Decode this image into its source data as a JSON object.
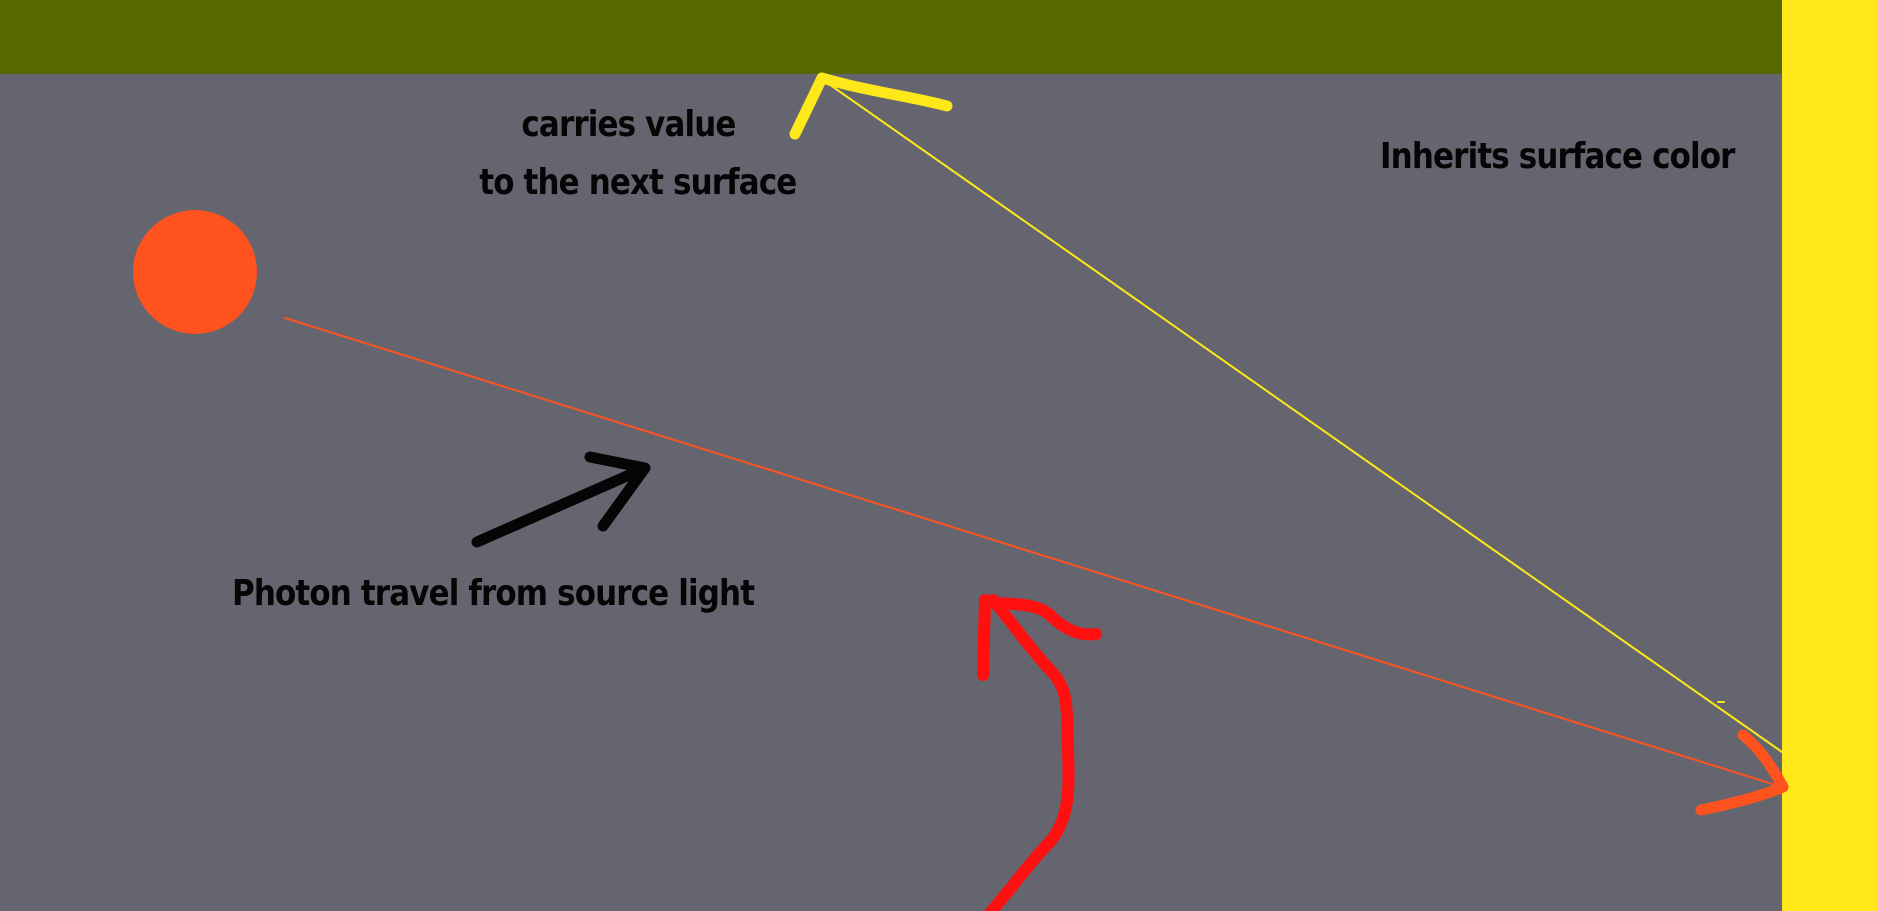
{
  "diagram": {
    "labels": {
      "top_line_1": "carries value",
      "top_line_2": "to the next surface",
      "right": "Inherits surface color",
      "bottom": "Photon travel from source light"
    },
    "colors": {
      "background": "#65656f",
      "ceiling": "#566800",
      "wall": "#ffe81a",
      "light_source": "#ff531f",
      "photon_ray": "#ff531f",
      "reflected_ray": "#ffe81a",
      "direction_arrow": "#050505",
      "pointer_arrow": "#ff1010",
      "text": "#050505"
    },
    "icons": {
      "light_source": "light-source-icon",
      "direction_arrow": "direction-arrow-icon",
      "pointer_arrow": "pointer-arrow-icon",
      "reflection_arrow": "reflection-arrow-icon"
    }
  }
}
